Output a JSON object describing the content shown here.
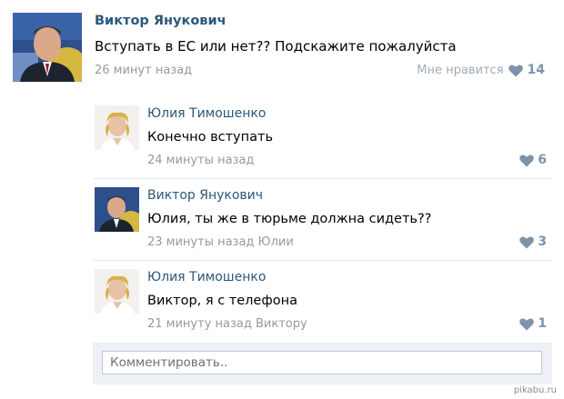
{
  "post": {
    "author": "Виктор Янукович",
    "text": "Вступать в ЕС или нет?? Подскажите пожалуйста",
    "time": "26 минут назад",
    "like_label": "Мне нравится",
    "like_count": "14"
  },
  "comments": [
    {
      "author": "Юлия Тимошенко",
      "text": "Конечно вступать",
      "time": "24 минуты назад",
      "like_count": "6"
    },
    {
      "author": "Виктор Янукович",
      "text": "Юлия, ты же в тюрьме должна сидеть??",
      "time": "23 минуты назад Юлии",
      "like_count": "3"
    },
    {
      "author": "Юлия Тимошенко",
      "text": "Виктор, я с телефона",
      "time": "21 минуту назад Виктору",
      "like_count": "1"
    }
  ],
  "comment_box": {
    "placeholder": "Комментировать.."
  },
  "watermark": "pikabu.ru",
  "colors": {
    "author_link": "#2b587a",
    "meta_gray": "#999999",
    "like_heart": "#7d93ab",
    "comment_box_bg": "#edf1f5"
  },
  "icons": {
    "like": "heart-icon"
  }
}
